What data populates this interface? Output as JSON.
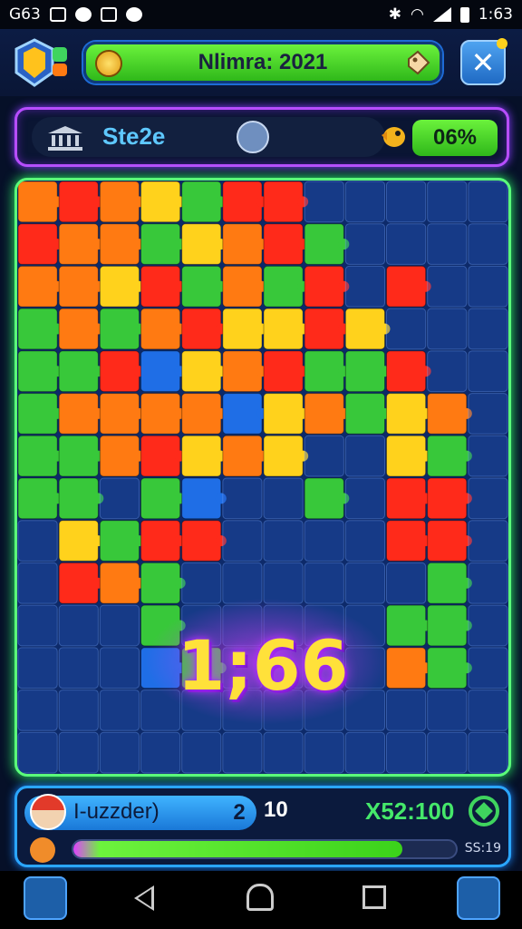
{
  "status_bar": {
    "left_text": "G63",
    "time": "1:63"
  },
  "header": {
    "title": "Nlimra: 2021",
    "close_label": "✕"
  },
  "stage": {
    "label": "Ste2e",
    "percent": "06%"
  },
  "board": {
    "score": "1;66",
    "colors": [
      "#ff2a1a",
      "#ff7a12",
      "#ffd21c",
      "#38c83a",
      "#1f6ee6"
    ]
  },
  "bottom": {
    "player_name": "I-uzzder)",
    "player_count": "2",
    "moves": "10",
    "score": "X52:100",
    "code": "SS:19",
    "progress_fraction": 0.86
  },
  "icons": {
    "logo": "shield-puzzle-icon",
    "coin": "coin-icon",
    "tag": "tag-icon",
    "bank": "bank-icon",
    "basket": "basket-icon",
    "bird": "bird-icon",
    "refresh": "refresh-icon",
    "heart": "heart-icon"
  },
  "accent_colors": {
    "stage_border": "#b84dff",
    "board_border": "#5bff7a",
    "bottom_border": "#2aa6ff",
    "green_pill": "#3bd21a"
  }
}
